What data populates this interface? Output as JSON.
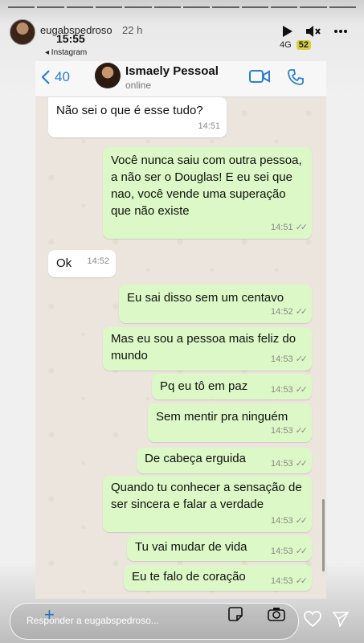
{
  "story": {
    "username": "eugabspedroso",
    "time": "22 h",
    "progress_segments": 12
  },
  "phone": {
    "time": "15:55",
    "network": "4G",
    "battery": "52",
    "back_app": "◂ Instagram"
  },
  "chat_header": {
    "back_count": "40",
    "contact_name": "Ismaely Pessoal",
    "status": "online"
  },
  "messages": [
    {
      "dir": "in",
      "text": "Não sei o que é esse tudo?",
      "time": "14:51"
    },
    {
      "dir": "out",
      "text": "Você nunca saiu com outra pessoa, a não ser o Douglas! E eu sei que nao, você vende uma superação que não existe",
      "time": "14:51"
    },
    {
      "dir": "in",
      "text": "Ok",
      "time": "14:52"
    },
    {
      "dir": "out",
      "text": "Eu sai disso sem um centavo",
      "time": "14:52"
    },
    {
      "dir": "out",
      "text": "Mas eu sou a pessoa mais feliz do mundo",
      "time": "14:53"
    },
    {
      "dir": "out",
      "text": "Pq eu tô em paz",
      "time": "14:53"
    },
    {
      "dir": "out",
      "text": "Sem mentir pra ninguém",
      "time": "14:53"
    },
    {
      "dir": "out",
      "text": "De cabeça erguida",
      "time": "14:53"
    },
    {
      "dir": "out",
      "text": "Quando tu conhecer a sensação de ser sincera e falar a verdade",
      "time": "14:53"
    },
    {
      "dir": "out",
      "text": "Tu vai mudar de vida",
      "time": "14:53"
    },
    {
      "dir": "out",
      "text": "Eu te falo de coração",
      "time": "14:53"
    }
  ],
  "reply": {
    "placeholder": "Responder a eugabspedroso..."
  },
  "icons": {
    "play": "play-icon",
    "mute": "mute-icon",
    "more": "more-icon",
    "video": "video-call-icon",
    "call": "phone-call-icon",
    "heart": "heart-icon",
    "send": "send-icon"
  }
}
